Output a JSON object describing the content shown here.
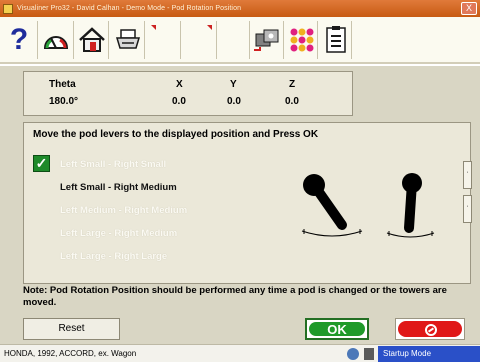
{
  "window": {
    "title": "Visualiner Pro32 - David Calhan - Demo Mode - Pod Rotation Position",
    "close_glyph": "X"
  },
  "toolbar": {
    "icons": [
      "help-icon",
      "gauge-icon",
      "home-icon",
      "printer-icon",
      "camera-swap-icon",
      "grid-dots-icon",
      "checklist-icon"
    ],
    "help_glyph": "?"
  },
  "data_table": {
    "headers": [
      "Theta",
      "X",
      "Y",
      "Z"
    ],
    "values": [
      "180.0°",
      "0.0",
      "0.0",
      "0.0"
    ]
  },
  "instructions": "Move the pod levers to the displayed position and Press OK",
  "options": [
    "Left Small - Right Small",
    "Left Small - Right Medium",
    "Left Medium - Right Medium",
    "Left Large - Right Medium",
    "Left Large - Right Large"
  ],
  "selected_option_index": 1,
  "checkbox_glyph": "✓",
  "scroll_glyph": "·",
  "note": "Note: Pod Rotation Position should be performed any time a pod is changed or the towers are moved.",
  "buttons": {
    "reset": "Reset",
    "ok": "OK"
  },
  "status": {
    "vehicle": "HONDA, 1992, ACCORD, ex. Wagon",
    "mode": "Startup Mode"
  },
  "colors": {
    "titlebar": "#c75a12",
    "ok_green": "#1f9a2a",
    "cancel_red": "#e01818",
    "status_blue": "#2a50c8"
  }
}
